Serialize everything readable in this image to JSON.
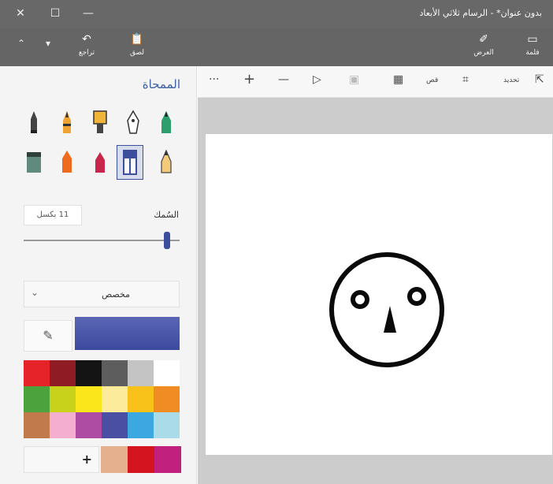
{
  "window": {
    "title": "بدون عنوان* - الرسام ثلاثي الأبعاد",
    "close_glyph": "✕",
    "maximize_glyph": "☐",
    "minimize_glyph": "—"
  },
  "ribbon": {
    "collapse_glyph": "⌃",
    "menu_glyph": "▾",
    "undo_label": "تراجع",
    "undo_icon": "↶",
    "paste_label": "لصق",
    "paste_icon": "📋",
    "view_label": "العرض",
    "view_icon": "✐",
    "brush_label": "فلمة",
    "brush_icon": "▭"
  },
  "panel": {
    "title": "الممحاة",
    "thickness_label": "السُمك",
    "thickness_value": "11 بكسل",
    "thickness_level_percent": 92,
    "dropdown_value": "مخصص",
    "dropdown_chevron": "⌄",
    "picker_icon": "✎",
    "current_color": "#3c4a9e",
    "swatches": [
      "#e52329",
      "#8f1c24",
      "#141414",
      "#5d5d5d",
      "#c4c4c4",
      "#ffffff",
      "#4ca33d",
      "#c9d21b",
      "#fbe51b",
      "#fdeb9c",
      "#f9c21a",
      "#ef8d24",
      "#c17a4b",
      "#f3aed0",
      "#ae4ca3",
      "#4a4fa4",
      "#3ba8e1",
      "#a9dce8"
    ],
    "add_label": "+",
    "custom_swatches": [
      "#e4b08e",
      "#d4151f",
      "#c1207e"
    ]
  },
  "canvas_toolbar": {
    "more_glyph": "···",
    "zoom_in_glyph": "+",
    "zoom_out_glyph": "—",
    "frame_glyph": "▷",
    "crop_label": "قص",
    "select_label": "تحديد",
    "select_icon": "⇱",
    "crop_icon": "⌗"
  }
}
